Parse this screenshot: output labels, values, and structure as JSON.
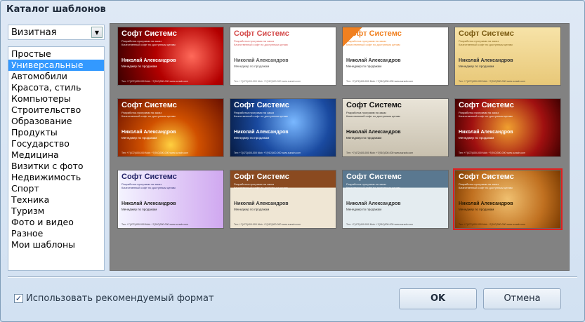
{
  "window": {
    "title": "Каталог шаблонов"
  },
  "format_select": {
    "value": "Визитная"
  },
  "categories": [
    {
      "label": "Простые"
    },
    {
      "label": "Универсальные",
      "selected": true
    },
    {
      "label": "Автомобили"
    },
    {
      "label": "Красота, стиль"
    },
    {
      "label": "Компьютеры"
    },
    {
      "label": "Строительство"
    },
    {
      "label": "Образование"
    },
    {
      "label": "Продукты"
    },
    {
      "label": "Государство"
    },
    {
      "label": "Медицина"
    },
    {
      "label": "Визитки с фото"
    },
    {
      "label": "Недвижимость"
    },
    {
      "label": "Спорт"
    },
    {
      "label": "Техника"
    },
    {
      "label": "Туризм"
    },
    {
      "label": "Фото и видео"
    },
    {
      "label": "Разное"
    },
    {
      "label": "Мои шаблоны"
    }
  ],
  "card_text": {
    "company": "Софт Системс",
    "tagline": "Разработка программ на заказ\nКачественный софт по доступным ценам",
    "name": "Николай Александров",
    "role": "Менеджер по продажам",
    "contacts": "Тел: +7(472)400-000  Mob: +7(910)300-000  www.suradn.com"
  },
  "templates": [
    {
      "bg": "radial-gradient(circle at 70% 50%,#ff6a5a,#b30000 45%,#3a0000)",
      "fg": "#ffffff"
    },
    {
      "bg": "#ffffff",
      "fg": "#d44a4a",
      "name_fg": "#555555"
    },
    {
      "bg": "linear-gradient(135deg,#f08020 0 12%,#ffffff 12%)",
      "fg": "#f08020",
      "name_fg": "#333333"
    },
    {
      "bg": "linear-gradient(#f7e3a8,#e8c878)",
      "fg": "#7a5a10",
      "name_fg": "#333333"
    },
    {
      "bg": "radial-gradient(circle at 50% 80%,#ffd040,#d05000 40%,#6a1000)",
      "fg": "#ffffff"
    },
    {
      "bg": "radial-gradient(circle at 60% 40%,#7ab8ff,#1a4aa0 50%,#061a40)",
      "fg": "#ffffff"
    },
    {
      "bg": "linear-gradient(#e9e4d8,#c8c0ae)",
      "fg": "#111111",
      "name_fg": "#111111"
    },
    {
      "bg": "radial-gradient(circle at 50% 50%,#f0a030,#a01010 60%,#400000)",
      "fg": "#ffffff"
    },
    {
      "bg": "linear-gradient(90deg,#f4f4ff,#d0a8f0)",
      "fg": "#222266",
      "name_fg": "#222222"
    },
    {
      "bg": "linear-gradient(#8a4a20 0 30%,#efe6d4 30% 100%)",
      "fg": "#ffffff",
      "name_fg": "#333333"
    },
    {
      "bg": "linear-gradient(#5a7890 0 30%,#e4ecf0 30% 100%)",
      "fg": "#ffffff",
      "name_fg": "#333333"
    },
    {
      "bg": "radial-gradient(circle at 50% 50%,#f0c070,#c07020 60%,#7a3a00)",
      "fg": "#ffffff",
      "name_fg": "#2a1a00",
      "selected": true
    }
  ],
  "options": {
    "use_recommended_format_label": "Использовать рекомендуемый формат",
    "use_recommended_format_checked": true
  },
  "buttons": {
    "ok": "OK",
    "cancel": "Отмена"
  }
}
